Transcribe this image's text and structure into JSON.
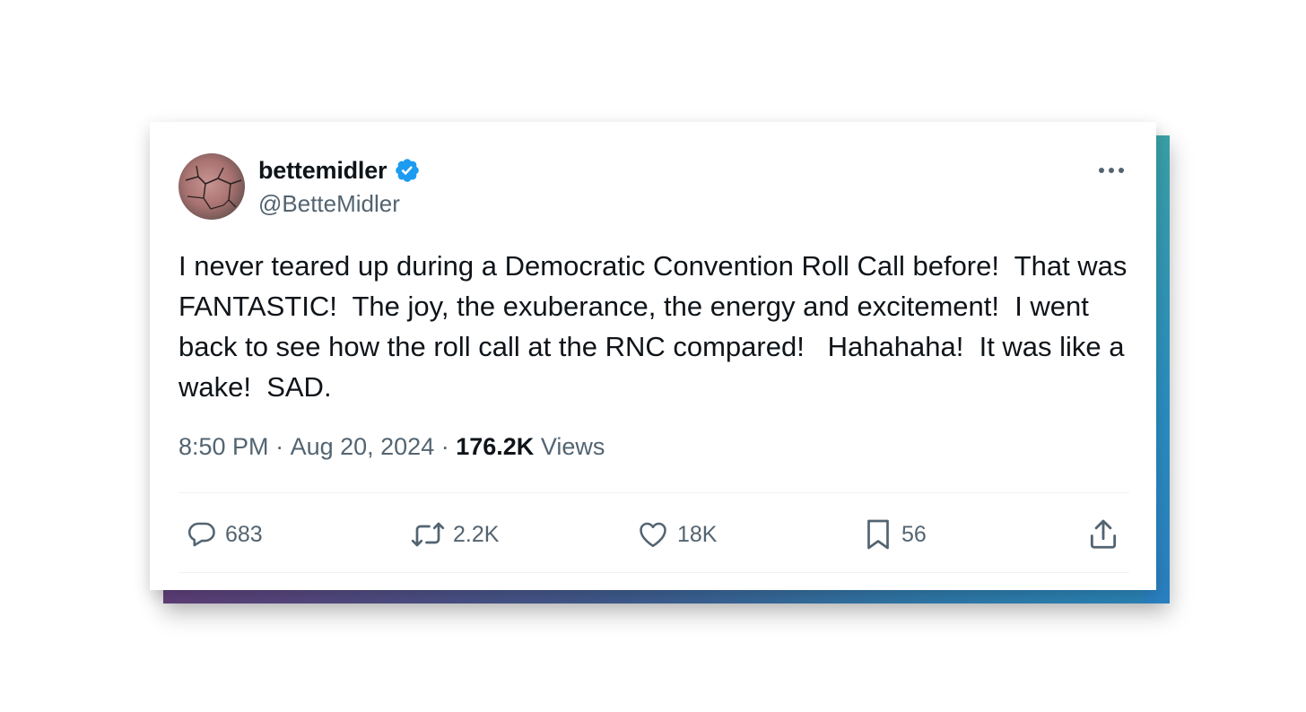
{
  "tweet": {
    "display_name": "bettemidler",
    "handle": "@BetteMidler",
    "text": "I never teared up during a Democratic Convention Roll Call before!  That was FANTASTIC!  The joy, the exuberance, the energy and excitement!  I went back to see how the roll call at the RNC compared!   Hahahaha!  It was like a wake!  SAD.",
    "time": "8:50 PM",
    "separator": " · ",
    "date": "Aug 20, 2024",
    "views_count": "176.2K",
    "views_label": "Views"
  },
  "actions": {
    "replies": "683",
    "reposts": "2.2K",
    "likes": "18K",
    "bookmarks": "56"
  },
  "colors": {
    "verified": "#1d9bf0",
    "text_primary": "#0f1419",
    "text_secondary": "#536471"
  },
  "icons": {
    "more": "more-horizontal-icon",
    "reply": "reply-icon",
    "repost": "repost-icon",
    "like": "heart-icon",
    "bookmark": "bookmark-icon",
    "share": "share-icon",
    "verified": "verified-badge-icon"
  }
}
